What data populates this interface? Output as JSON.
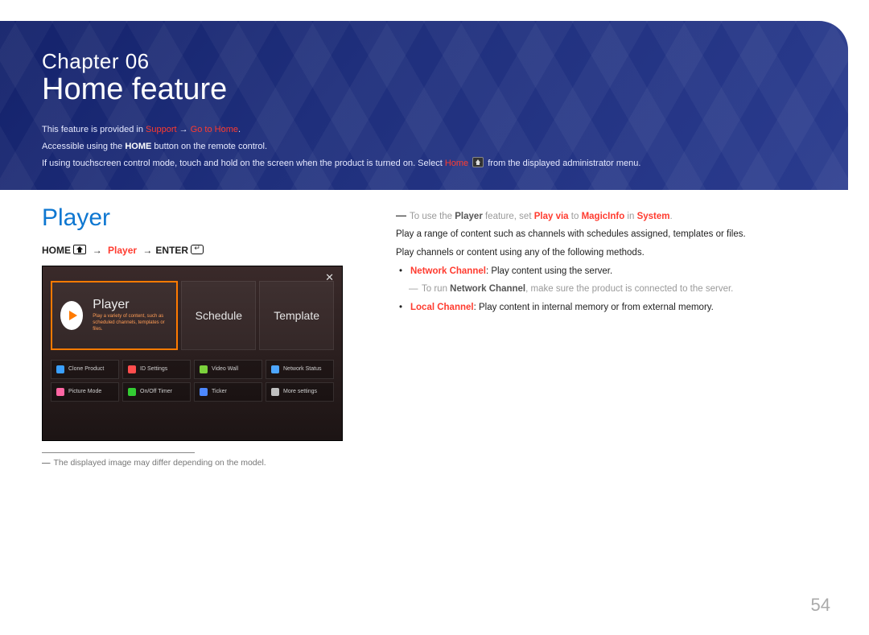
{
  "header": {
    "chapter_line": "Chapter  06",
    "title": "Home feature",
    "intro": {
      "l1_pre": "This feature is provided in ",
      "l1_red1": "Support",
      "l1_arrow": " → ",
      "l1_red2": "Go to Home",
      "l1_post": ".",
      "l2_pre": "Accessible using the ",
      "l2_bold": "HOME",
      "l2_post": " button on the remote control.",
      "l3_pre": "If using touchscreen control mode, touch and hold on the screen when the product is turned on. Select ",
      "l3_red": "Home",
      "l3_post": " from the displayed administrator menu."
    }
  },
  "left": {
    "section_heading": "Player",
    "breadcrumb": {
      "home": "HOME",
      "player": "Player",
      "enter": "ENTER"
    },
    "shot": {
      "player_title": "Player",
      "player_sub": "Play a variety of content, such as scheduled channels, templates or files.",
      "schedule": "Schedule",
      "template": "Template",
      "cells": [
        {
          "label": "Clone Product",
          "color": "#3aa0ff"
        },
        {
          "label": "ID Settings",
          "color": "#ff4d4d"
        },
        {
          "label": "Video Wall",
          "color": "#7bd13c"
        },
        {
          "label": "Network Status",
          "color": "#4da6ff"
        },
        {
          "label": "Picture Mode",
          "color": "#ff66a3"
        },
        {
          "label": "On/Off Timer",
          "color": "#33cc33"
        },
        {
          "label": "Ticker",
          "color": "#4d88ff"
        },
        {
          "label": "More settings",
          "color": "#c0c0c0"
        }
      ]
    },
    "footnote": "The displayed image may differ depending on the model."
  },
  "right": {
    "note1_pre": "To use the ",
    "note1_b1": "Player",
    "note1_mid1": " feature, set ",
    "note1_r1": "Play via",
    "note1_mid2": " to ",
    "note1_r2": "MagicInfo",
    "note1_mid3": " in ",
    "note1_r3": "System",
    "note1_post": ".",
    "p1": "Play a range of content such as channels with schedules assigned, templates or files.",
    "p2": "Play channels or content using any of the following methods.",
    "b1_r": "Network Channel",
    "b1_t": ": Play content using the server.",
    "sub_pre": "To run ",
    "sub_b": "Network Channel",
    "sub_post": ", make sure the product is connected to the server.",
    "b2_r": "Local Channel",
    "b2_t": ": Play content in internal memory or from external memory."
  },
  "page_number": "54"
}
